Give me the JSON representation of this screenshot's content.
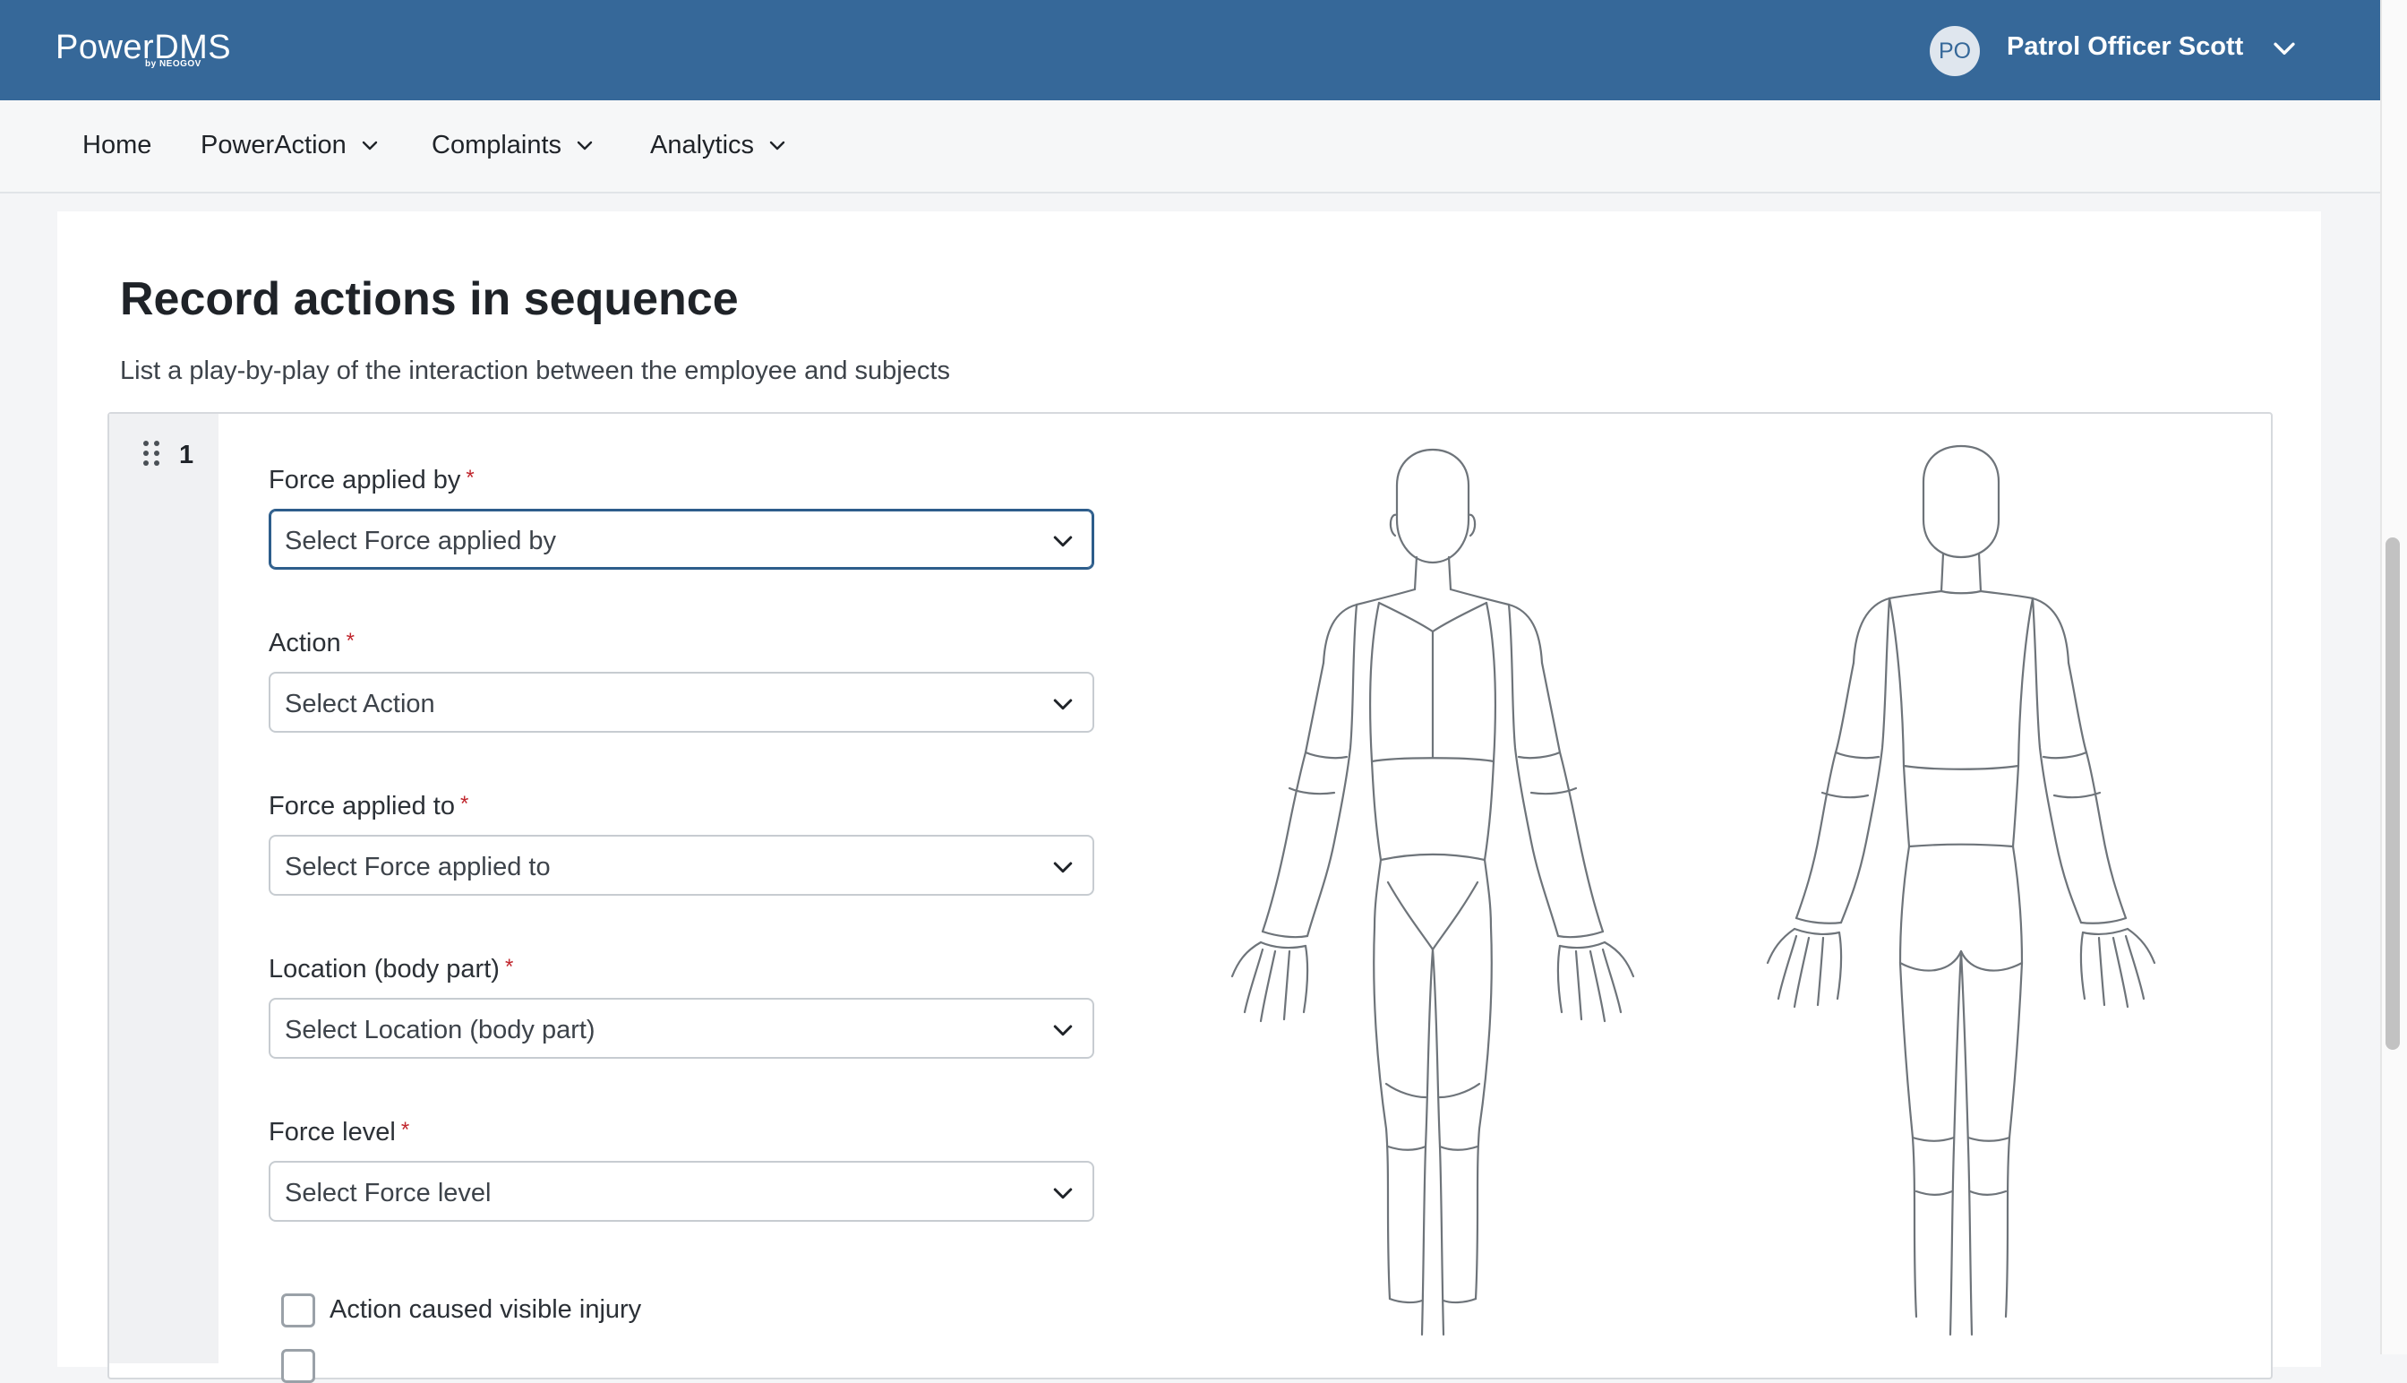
{
  "header": {
    "logo_main": "PowerDMS",
    "logo_sub": "by NEOGOV",
    "avatar_initials": "PO",
    "user_name": "Patrol Officer Scott"
  },
  "nav": {
    "items": [
      {
        "label": "Home"
      },
      {
        "label": "PowerAction"
      },
      {
        "label": "Complaints"
      },
      {
        "label": "Analytics"
      }
    ]
  },
  "section": {
    "title": "Record actions in sequence",
    "subtitle": "List a play-by-play of the interaction between the employee and subjects",
    "step_number": "1"
  },
  "form": {
    "force_applied_by": {
      "label": "Force applied by",
      "placeholder": "Select Force applied by"
    },
    "action": {
      "label": "Action",
      "placeholder": "Select Action"
    },
    "force_applied_to": {
      "label": "Force applied to",
      "placeholder": "Select Force applied to"
    },
    "location": {
      "label": "Location (body part)",
      "placeholder": "Select Location (body part)"
    },
    "force_level": {
      "label": "Force level",
      "placeholder": "Select Force level"
    },
    "required_marker": "*",
    "visible_injury": {
      "label": "Action caused visible injury",
      "checked": false
    }
  },
  "colors": {
    "brand": "#366899",
    "focus_border": "#2d5d8b",
    "required": "#c0262d"
  }
}
